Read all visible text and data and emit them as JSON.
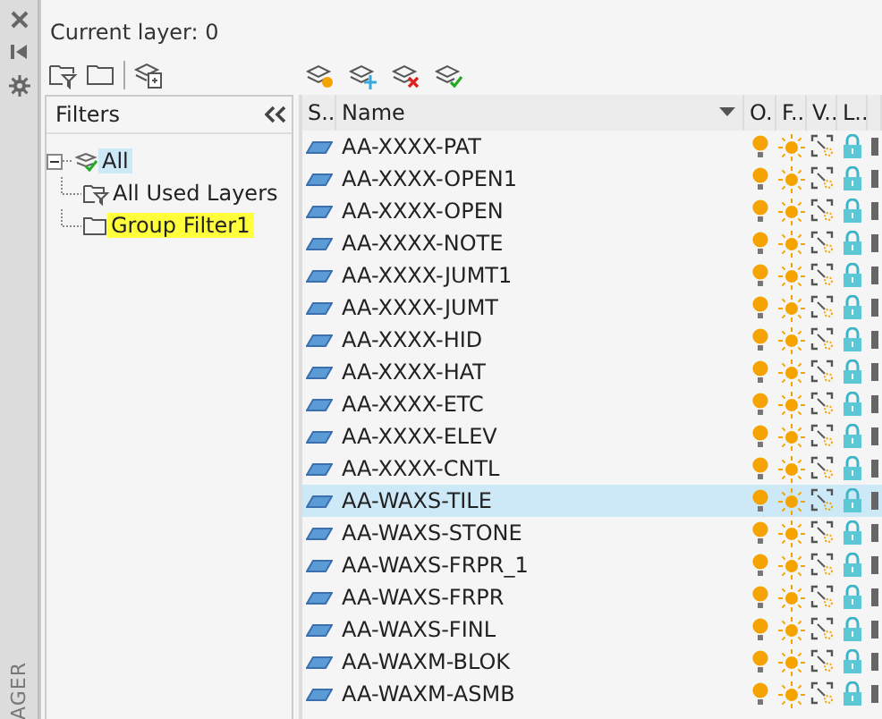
{
  "side_strip": {
    "title": "AGER"
  },
  "current_layer": "Current layer: 0",
  "filters": {
    "title": "Filters",
    "tree": [
      {
        "label": "All",
        "selected": true,
        "expanded": true,
        "children": [
          {
            "label": "All Used Layers",
            "kind": "property",
            "highlighted": false
          },
          {
            "label": "Group Filter1",
            "kind": "group",
            "highlighted": true
          }
        ]
      }
    ]
  },
  "table": {
    "columns": [
      "S..",
      "Name",
      "O..",
      "F..",
      "V..",
      "L.."
    ],
    "rows": [
      {
        "name": "AA-XXXX-PAT",
        "selected": false,
        "on": true,
        "frozen": false
      },
      {
        "name": "AA-XXXX-OPEN1",
        "selected": false,
        "on": true,
        "frozen": false
      },
      {
        "name": "AA-XXXX-OPEN",
        "selected": false,
        "on": true,
        "frozen": false
      },
      {
        "name": "AA-XXXX-NOTE",
        "selected": false,
        "on": true,
        "frozen": false
      },
      {
        "name": "AA-XXXX-JUMT1",
        "selected": false,
        "on": true,
        "frozen": false
      },
      {
        "name": "AA-XXXX-JUMT",
        "selected": false,
        "on": true,
        "frozen": false
      },
      {
        "name": "AA-XXXX-HID",
        "selected": false,
        "on": true,
        "frozen": false
      },
      {
        "name": "AA-XXXX-HAT",
        "selected": false,
        "on": true,
        "frozen": false
      },
      {
        "name": "AA-XXXX-ETC",
        "selected": false,
        "on": true,
        "frozen": false
      },
      {
        "name": "AA-XXXX-ELEV",
        "selected": false,
        "on": true,
        "frozen": false
      },
      {
        "name": "AA-XXXX-CNTL",
        "selected": false,
        "on": true,
        "frozen": false
      },
      {
        "name": "AA-WAXS-TILE",
        "selected": true,
        "on": true,
        "frozen": false
      },
      {
        "name": "AA-WAXS-STONE",
        "selected": false,
        "on": true,
        "frozen": false
      },
      {
        "name": "AA-WAXS-FRPR_1",
        "selected": false,
        "on": true,
        "frozen": false
      },
      {
        "name": "AA-WAXS-FRPR",
        "selected": false,
        "on": true,
        "frozen": false
      },
      {
        "name": "AA-WAXS-FINL",
        "selected": false,
        "on": true,
        "frozen": false
      },
      {
        "name": "AA-WAXM-BLOK",
        "selected": false,
        "on": true,
        "frozen": false
      },
      {
        "name": "AA-WAXM-ASMB",
        "selected": false,
        "on": true,
        "frozen": false
      }
    ]
  }
}
